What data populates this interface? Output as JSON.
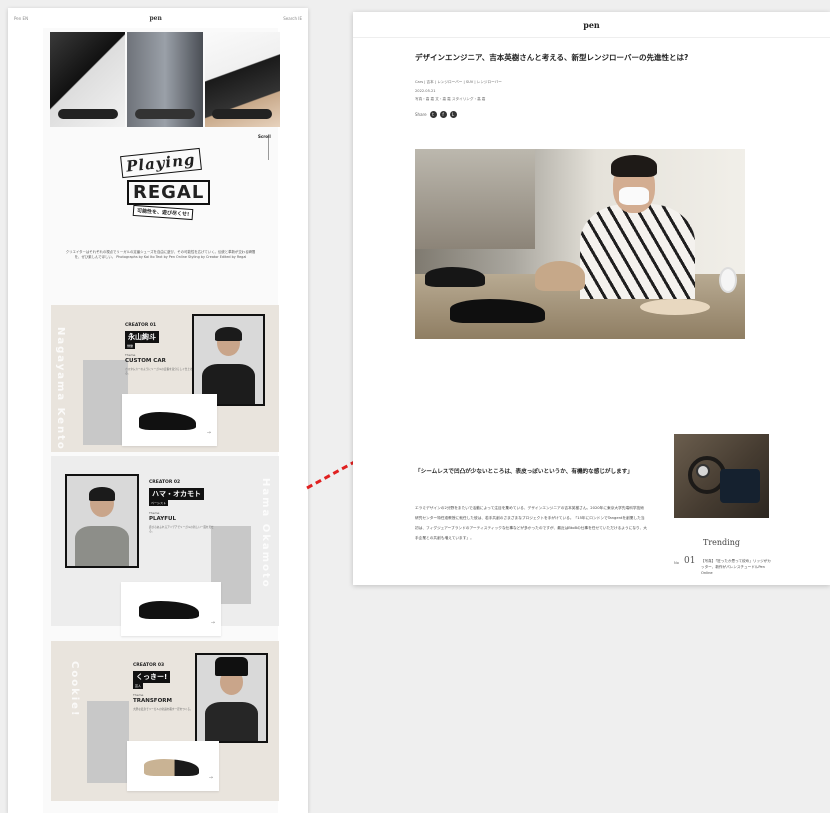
{
  "left_page": {
    "top_left": "Pen EN",
    "logo": "pen",
    "top_right": "Search  IE",
    "menu_label": "Scroll",
    "logo_playing": "Playing",
    "logo_regal": "REGAL",
    "logo_sub": "可能性を、遊び尽くせ!",
    "intro_text": "クリエイターはそれぞれの視点でリーガルの定番シューズを自由に遊び、その可能性を広げていく。伝統と革新が交わる瞬間を、ぜひ楽しんでほしい。 Photographs by Kai Ito  Text by Pen Online  Styling by Creator  Edited by Regal",
    "creators": [
      {
        "label": "CREATOR 01",
        "name": "永山絢斗",
        "tag": "俳優",
        "theme_label": "Theme",
        "theme": "CUSTOM CAR",
        "vertical": "Nagayama Kento",
        "desc": "カスタムカーのようにリーガルの定番を自分らしく仕上げる。",
        "arrow": "→"
      },
      {
        "label": "CREATOR 02",
        "name": "ハマ・オカモト",
        "tag": "ベーシスト",
        "theme_label": "Theme",
        "theme": "PLAYFUL",
        "vertical": "Hama Okamoto",
        "desc": "遊び心あふれるアイデアでリーガルの新しい一面を見せる。",
        "arrow": "→"
      },
      {
        "label": "CREATOR 03",
        "name": "くっきー!",
        "tag": "芸人",
        "theme_label": "Theme",
        "theme": "TRANSFORM",
        "vertical": "Cookie!",
        "desc": "大胆な変身でリーガルの常識を覆す一足をつくる。",
        "arrow": "→"
      }
    ]
  },
  "right_page": {
    "logo": "pen",
    "title": "デザインエンジニア、吉本英樹さんと考える、新型レンジローバーの先進性とは?",
    "tags": "Cars | 吉本 | レンジローバー | SUV | レンジローバー",
    "date": "2022.05.21",
    "credit": "写真・高 嘉  文・高 嘉  スタイリング・高 嘉",
    "share_label": "Share",
    "quote": "「シームレスで凹凸が少ないところは、表皮っぽいというか、有機的な感じがします」",
    "body": "エラミデザインの2分野をまたいで活動によって注目を集めている、デザインエンジニアの吉本英樹さん。2020年に東京大学先端科学技術研究センター特任准教授に就任した彼は、若手共創のさまざまなプロジェクトを手がけている。「15年にロンドンでTangentを創業した当初は、フィグジュアーブランドのアーティスティックな仕事などが多かったのですが、最近はBtoBの仕事を任せていただけるようになり、大手企業との共創も増えています」。",
    "trending": "Trending",
    "rank_prefix": "No",
    "rank_num": "01",
    "rank_text": "【写真】「狂ったか思って絞め」リッジがカッター、新作がパレンスチュードルPen Online"
  }
}
